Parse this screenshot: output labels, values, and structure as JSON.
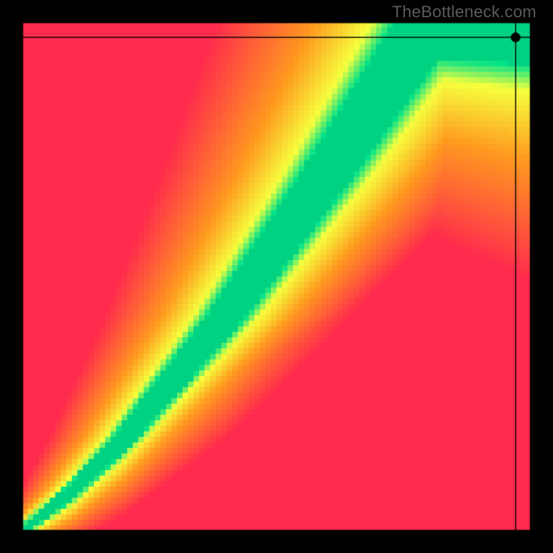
{
  "watermark": "TheBottleneck.com",
  "colors": {
    "background": "#000000",
    "watermark_text": "#5a5a5a",
    "heat_best": "#00e28a",
    "heat_good": "#f6ff3d",
    "heat_mid": "#ff9a1f",
    "heat_bad": "#ff2a4d",
    "marker": "#000000",
    "axis_line": "#000000"
  },
  "chart_data": {
    "type": "heatmap",
    "title": "",
    "xlabel": "",
    "ylabel": "",
    "xlim": [
      0,
      100
    ],
    "ylim": [
      0,
      100
    ],
    "grid": false,
    "legend": false,
    "description": "Bottleneck compatibility heatmap. Green diagonal band indicates balanced CPU/GPU pairing; red regions indicate severe bottleneck; yellow/orange transitional.",
    "optimal_band": {
      "type": "curve",
      "points_xy": [
        [
          0,
          0
        ],
        [
          10,
          8
        ],
        [
          20,
          18
        ],
        [
          30,
          30
        ],
        [
          40,
          42
        ],
        [
          50,
          56
        ],
        [
          60,
          70
        ],
        [
          70,
          85
        ],
        [
          76,
          94
        ],
        [
          80,
          100
        ]
      ],
      "band_half_width_pct_at_x": [
        [
          0,
          1.0
        ],
        [
          20,
          2.5
        ],
        [
          40,
          4.0
        ],
        [
          60,
          5.5
        ],
        [
          80,
          7.0
        ],
        [
          100,
          8.5
        ]
      ]
    },
    "marker": {
      "x": 97,
      "y": 97,
      "radius_px": 7
    },
    "crosshair": {
      "x": 97,
      "y": 97
    }
  }
}
